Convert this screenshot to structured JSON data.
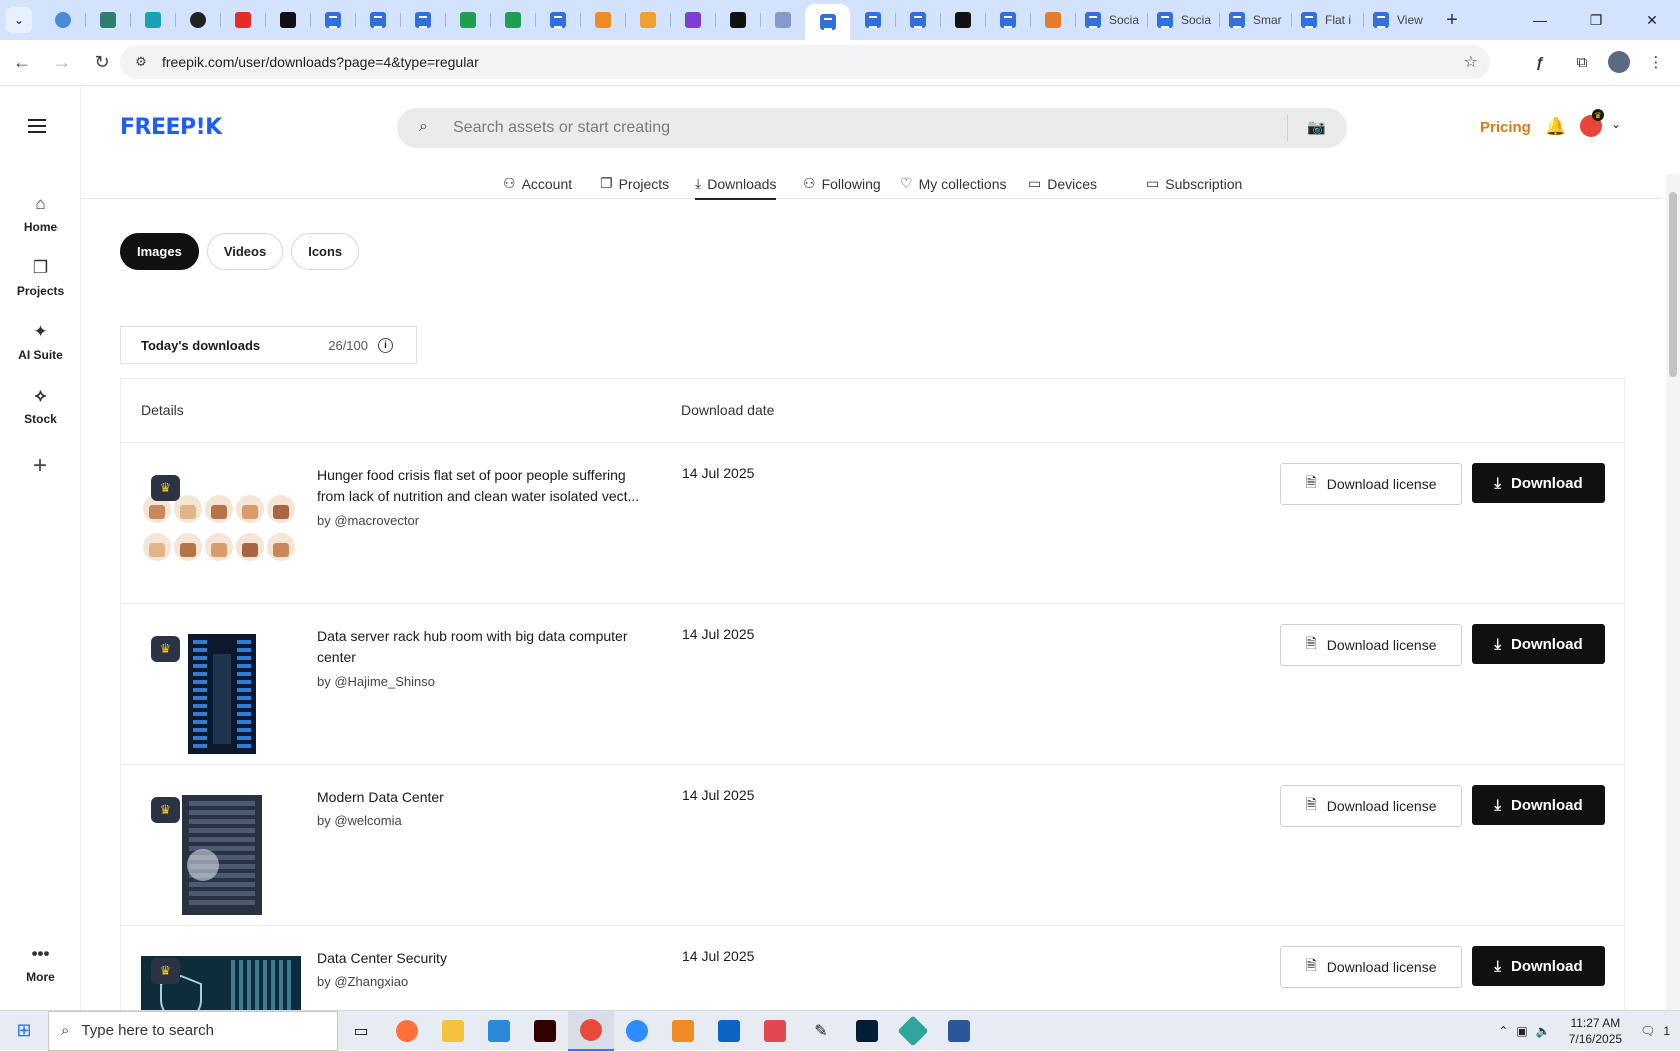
{
  "browser": {
    "tabs": [
      {
        "icon": "globe-icon",
        "color": "#4a8bd6"
      },
      {
        "icon": "vpn-icon",
        "color": "#2e7d6f"
      },
      {
        "icon": "arrow-icon",
        "color": "#17a2b8"
      },
      {
        "icon": "openai-icon",
        "color": "#222222"
      },
      {
        "icon": "youtube-icon",
        "color": "#e52d27"
      },
      {
        "icon": "bolt-icon",
        "color": "#111111"
      },
      {
        "icon": "docs-icon",
        "color": "#2f6fdf"
      },
      {
        "icon": "docs-icon",
        "color": "#2f6fdf"
      },
      {
        "icon": "docs-icon",
        "color": "#2f6fdf"
      },
      {
        "icon": "sheets-icon",
        "color": "#1e9e4f"
      },
      {
        "icon": "sheets-icon",
        "color": "#1e9e4f"
      },
      {
        "icon": "word-icon",
        "color": "#2f6fdf"
      },
      {
        "icon": "xampp-icon",
        "color": "#f08a24"
      },
      {
        "icon": "v-icon",
        "color": "#f0a030"
      },
      {
        "icon": "brackets-icon",
        "color": "#7b3fd1"
      },
      {
        "icon": "a-icon",
        "color": "#111111"
      },
      {
        "icon": "grid-icon",
        "color": "#8899cc"
      },
      {
        "icon": "freepik-icon",
        "color": "#2f6fdf"
      },
      {
        "icon": "freepik-icon",
        "color": "#2f6fdf"
      },
      {
        "icon": "freepik-icon",
        "color": "#2f6fdf"
      },
      {
        "icon": "m-icon",
        "color": "#111111"
      },
      {
        "icon": "freepik-icon",
        "color": "#2f6fdf"
      },
      {
        "icon": "cursor-icon",
        "color": "#e57c2a"
      }
    ],
    "named_tabs": [
      {
        "label": "Socia"
      },
      {
        "label": "Socia"
      },
      {
        "label": "Smar"
      },
      {
        "label": "Flat i"
      },
      {
        "label": "View"
      }
    ],
    "new_tab": "+",
    "url": "freepik.com/user/downloads?page=4&type=regular"
  },
  "header": {
    "logo": "FREEP!K",
    "search_placeholder": "Search assets or start creating",
    "pricing": "Pricing"
  },
  "sidebar": {
    "items": [
      {
        "label": "Home",
        "icon": "home-icon"
      },
      {
        "label": "Projects",
        "icon": "projects-icon"
      },
      {
        "label": "AI Suite",
        "icon": "sparkle-icon"
      },
      {
        "label": "Stock",
        "icon": "stock-icon"
      }
    ],
    "more": "More"
  },
  "subnav": [
    {
      "label": "Account",
      "icon": "user-icon"
    },
    {
      "label": "Projects",
      "icon": "projects-icon"
    },
    {
      "label": "Downloads",
      "icon": "download-icon",
      "active": true
    },
    {
      "label": "Following",
      "icon": "follow-icon"
    },
    {
      "label": "My collections",
      "icon": "heart-icon"
    },
    {
      "label": "Devices",
      "icon": "laptop-icon"
    },
    {
      "label": "Subscription",
      "icon": "card-icon"
    }
  ],
  "filters": [
    {
      "label": "Images",
      "active": true
    },
    {
      "label": "Videos",
      "active": false
    },
    {
      "label": "Icons",
      "active": false
    }
  ],
  "today": {
    "label": "Today's downloads",
    "count": "26/100"
  },
  "table": {
    "headers": {
      "details": "Details",
      "date": "Download date"
    },
    "rows": [
      {
        "title_line1": "Hunger food crisis flat set of poor people suffering",
        "title_line2": "from lack of nutrition and clean water isolated vect...",
        "author": "by @macrovector",
        "date": "14 Jul 2025",
        "thumb": "illustration-grid"
      },
      {
        "title_line1": "Data server rack hub room with big data computer",
        "title_line2": "center",
        "author": "by @Hajime_Shinso",
        "date": "14 Jul 2025",
        "thumb": "server-blue"
      },
      {
        "title_line1": "Modern Data Center",
        "title_line2": "",
        "author": "by @welcomia",
        "date": "14 Jul 2025",
        "thumb": "server-dark"
      },
      {
        "title_line1": "Data Center Security",
        "title_line2": "",
        "author": "by @Zhangxiao",
        "date": "14 Jul 2025",
        "thumb": "security-teal"
      }
    ],
    "license_label": "Download license",
    "download_label": "Download"
  },
  "taskbar": {
    "search_placeholder": "Type here to search",
    "time": "11:27 AM",
    "date": "7/16/2025",
    "notification_count": "1"
  }
}
